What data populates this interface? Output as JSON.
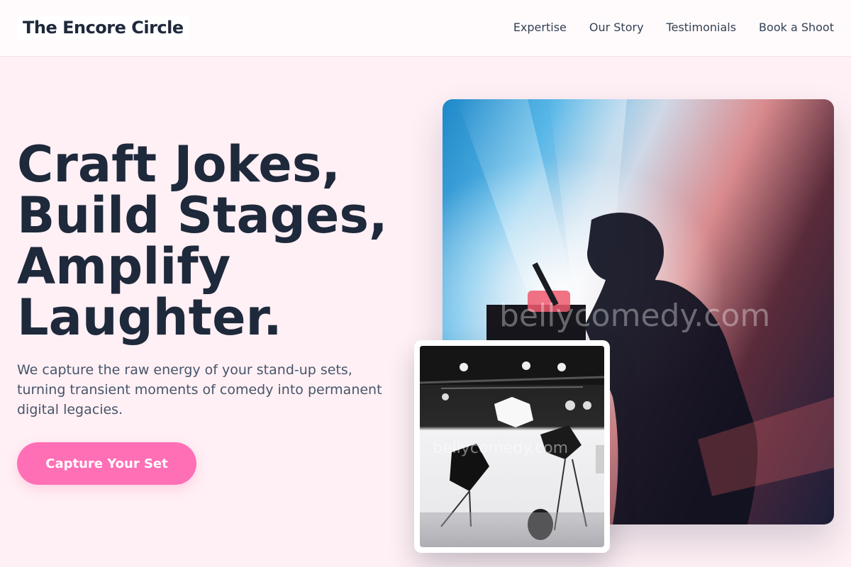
{
  "header": {
    "brand": "The Encore Circle",
    "nav": [
      "Expertise",
      "Our Story",
      "Testimonials",
      "Book a Shoot"
    ]
  },
  "hero": {
    "title_lines": [
      "Craft Jokes,",
      "Build Stages,",
      "Amplify",
      "Laughter."
    ],
    "subtitle": "We capture the raw energy of your stand-up sets, turning transient moments of comedy into permanent digital legacies.",
    "cta_label": "Capture Your Set"
  },
  "images": {
    "main_watermark": "bellycomedy.com",
    "inset_watermark": "bellycomedy.com"
  },
  "colors": {
    "background": "#fff0f5",
    "accent": "#ff6fb5",
    "text": "#1e293b"
  }
}
